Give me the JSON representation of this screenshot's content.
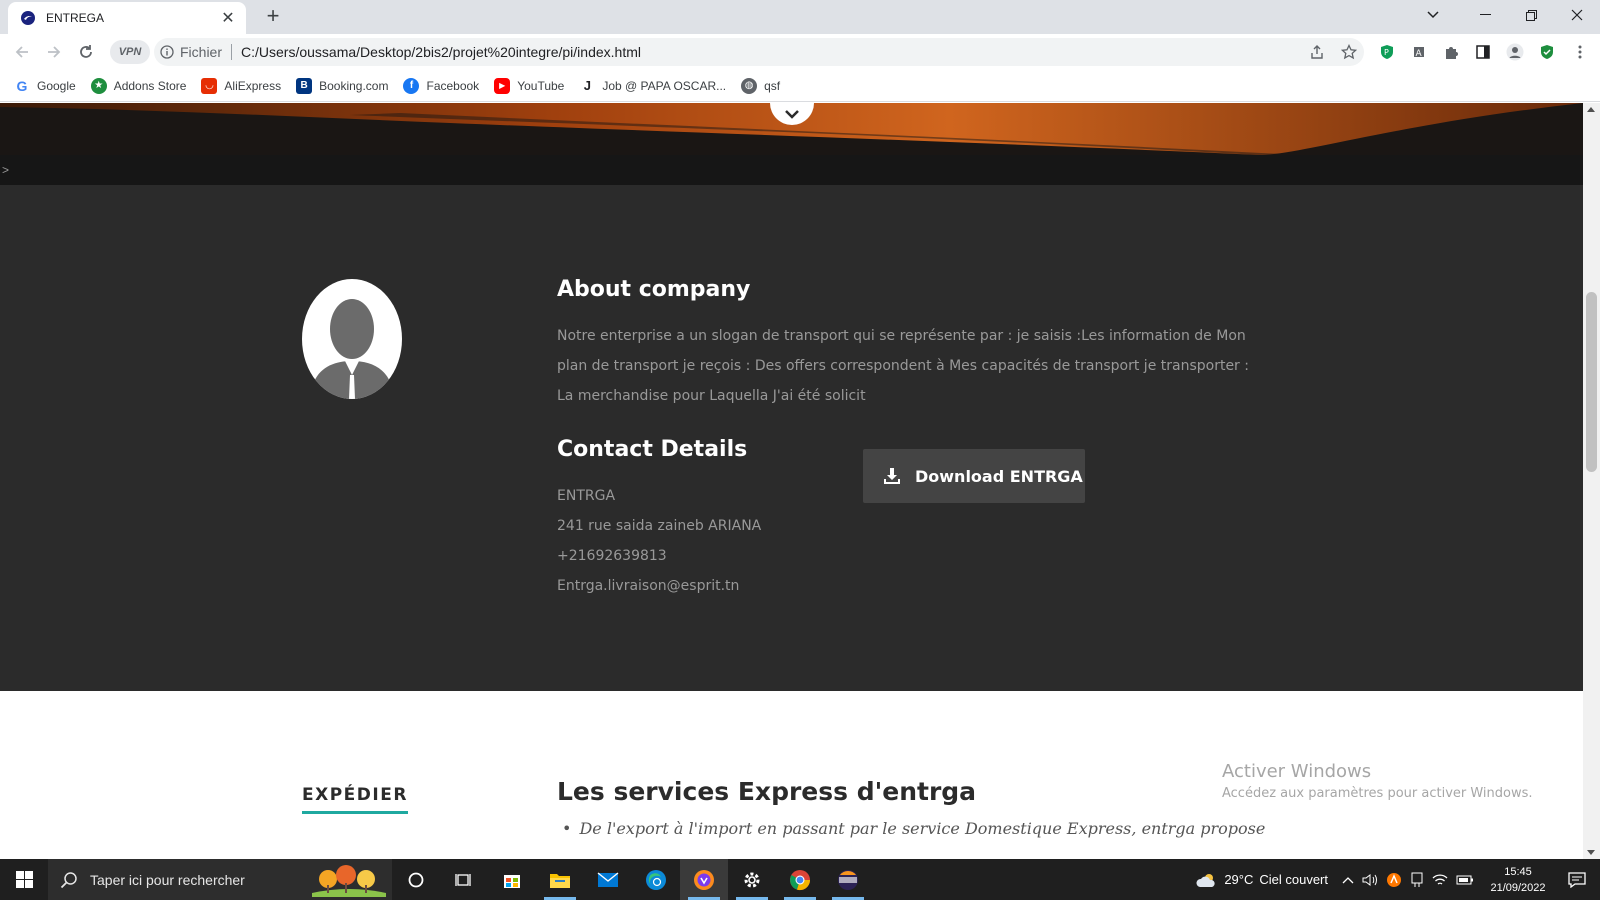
{
  "browser": {
    "tab": {
      "title": "ENTREGA",
      "close": "✕"
    },
    "new_tab": "+",
    "vpn": "VPN",
    "omnibox": {
      "security_label": "Fichier",
      "url": "C:/Users/oussama/Desktop/2bis2/projet%20integre/pi/index.html"
    },
    "bookmarks": [
      {
        "label": "Google",
        "icon": "google-icon",
        "color": "#4285f4"
      },
      {
        "label": "Addons Store",
        "icon": "addons-store-icon",
        "color": "#1e8e3e"
      },
      {
        "label": "AliExpress",
        "icon": "aliexpress-icon",
        "color": "#e62e04"
      },
      {
        "label": "Booking.com",
        "icon": "booking-icon",
        "color": "#003580"
      },
      {
        "label": "Facebook",
        "icon": "facebook-icon",
        "color": "#1877f2"
      },
      {
        "label": "YouTube",
        "icon": "youtube-icon",
        "color": "#ff0000"
      },
      {
        "label": "Job @ PAPA OSCAR...",
        "icon": "job-icon",
        "color": "#202124"
      },
      {
        "label": "qsf",
        "icon": "globe-icon",
        "color": "#5f6368"
      }
    ]
  },
  "page": {
    "strip_text": ">",
    "about": {
      "heading": "About company",
      "text": "Notre enterprise a un slogan de transport qui se représente par : je saisis :Les information de Mon plan de transport je reçois : Des offers correspondent à Mes capacités de transport je transporter : La merchandise pour Laquella J'ai été solicit"
    },
    "contact": {
      "heading": "Contact Details",
      "items": [
        "ENTRGA",
        "241 rue saida zaineb ARIANA",
        "+21692639813",
        "Entrga.livraison@esprit.tn"
      ]
    },
    "download_button": "Download ENTRGA",
    "services": {
      "tab_label": "EXPÉDIER",
      "heading": "Les services Express d'entrga",
      "bullet": "De l'export à l'import en passant par le service Domestique Express, entrga propose"
    },
    "accent_color": "#1fa9a0"
  },
  "windows_watermark": {
    "title": "Activer Windows",
    "subtitle": "Accédez aux paramètres pour activer Windows."
  },
  "taskbar": {
    "search_placeholder": "Taper ici pour rechercher",
    "weather": {
      "temp": "29°C",
      "condition": "Ciel couvert"
    },
    "clock": {
      "time": "15:45",
      "date": "21/09/2022"
    }
  }
}
